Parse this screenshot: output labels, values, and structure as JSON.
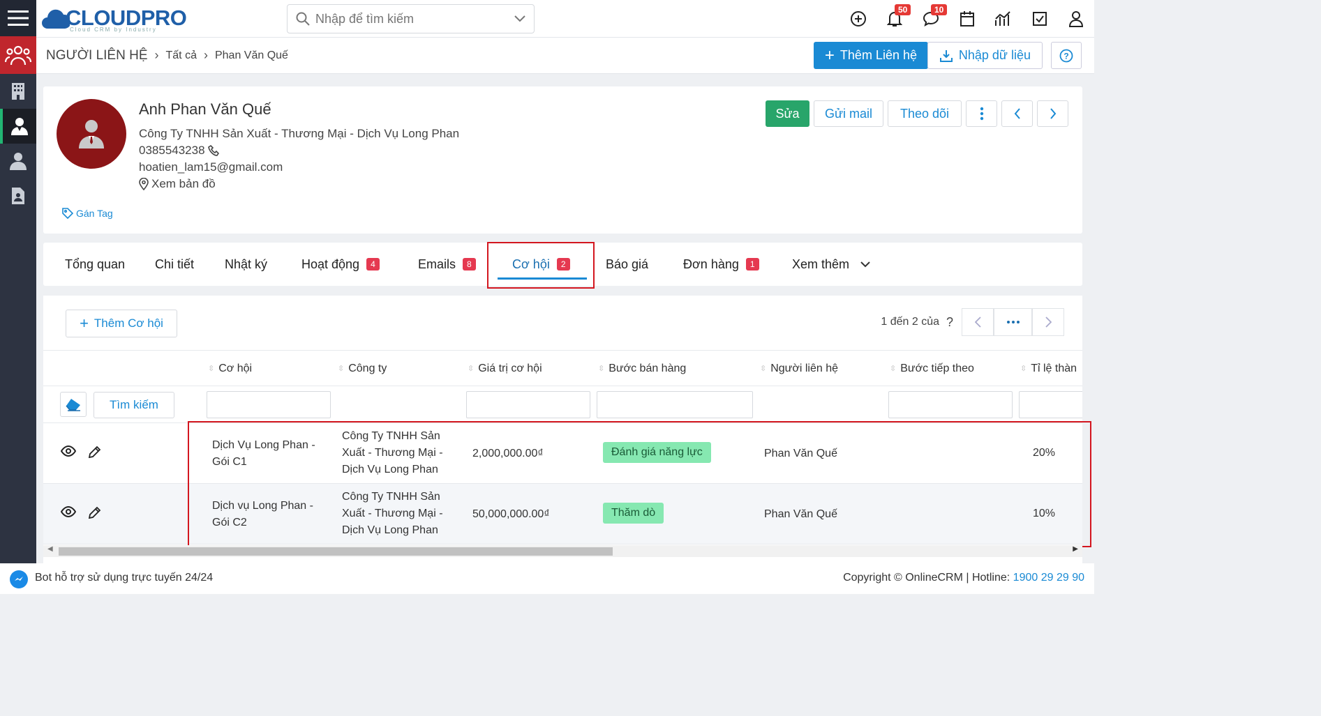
{
  "brand": {
    "name": "CLOUDPRO",
    "tagline": "Cloud CRM by Industry"
  },
  "search": {
    "placeholder": "Nhập để tìm kiếm"
  },
  "notifications": {
    "bell_count": "50",
    "chat_count": "10"
  },
  "breadcrumb": {
    "module": "NGƯỜI LIÊN HỆ",
    "all": "Tất cả",
    "current": "Phan Văn Quế"
  },
  "header_actions": {
    "add": "Thêm Liên hệ",
    "import": "Nhập dữ liệu"
  },
  "contact": {
    "name": "Anh Phan Văn Quế",
    "company": "Công Ty TNHH Sản Xuất - Thương Mại - Dịch Vụ Long Phan",
    "phone": "0385543238",
    "email": "hoatien_lam15@gmail.com",
    "map": "Xem bản đồ",
    "tag": "Gán Tag"
  },
  "card_actions": {
    "edit": "Sửa",
    "send_mail": "Gửi mail",
    "follow": "Theo dõi"
  },
  "tabs": [
    {
      "label": "Tổng quan",
      "count": ""
    },
    {
      "label": "Chi tiết",
      "count": ""
    },
    {
      "label": "Nhật ký",
      "count": ""
    },
    {
      "label": "Hoạt động",
      "count": "4"
    },
    {
      "label": "Emails",
      "count": "8"
    },
    {
      "label": "Cơ hội",
      "count": "2"
    },
    {
      "label": "Báo giá",
      "count": ""
    },
    {
      "label": "Đơn hàng",
      "count": "1"
    },
    {
      "label": "Xem thêm",
      "count": ""
    }
  ],
  "opps": {
    "add_label": "Thêm Cơ hội",
    "pager_text": "1 đến 2 của",
    "pager_q": "?",
    "find_label": "Tìm kiếm",
    "columns": [
      "Cơ hội",
      "Công ty",
      "Giá trị cơ hội",
      "Bước bán hàng",
      "Người liên hệ",
      "Bước tiếp theo",
      "Tỉ lệ thàn"
    ],
    "rows": [
      {
        "name": "Dịch Vụ Long Phan - Gói C1",
        "company": "Công Ty TNHH Sản Xuất - Thương Mại - Dịch Vụ Long Phan",
        "value": "2,000,000.00₫",
        "stage": "Đánh giá năng lực",
        "contact": "Phan Văn Quế",
        "next": "",
        "rate": "20%"
      },
      {
        "name": "Dịch vụ Long Phan - Gói C2",
        "company": "Công Ty TNHH Sản Xuất - Thương Mại - Dịch Vụ Long Phan",
        "value": "50,000,000.00₫",
        "stage": "Thăm dò",
        "contact": "Phan Văn Quế",
        "next": "",
        "rate": "10%"
      }
    ]
  },
  "footer": {
    "bot": "Bot hỗ trợ sử dụng trực tuyến 24/24",
    "copyright": "Copyright © OnlineCRM | Hotline: ",
    "hotline": "1900 29 29 90"
  },
  "colors": {
    "primary": "#1a8ad4",
    "edit_green": "#28a56a",
    "sidebar": "#2d3341",
    "badge_red": "#e53950",
    "highlight": "#d3161f",
    "stage_green": "#86e8b1",
    "avatar": "#8b1517"
  }
}
